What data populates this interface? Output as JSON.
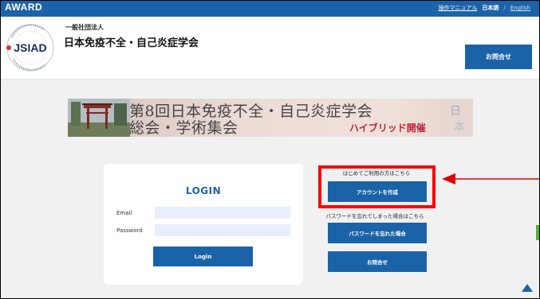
{
  "topbar": {
    "brand": "AWARD",
    "manual_link": "操作マニュアル",
    "lang_ja": "日本語",
    "separator": "/",
    "lang_en": "English"
  },
  "header": {
    "logo_text": "JSIAD",
    "org_type": "一般社団法人",
    "org_name": "日本免疫不全・自己炎症学会",
    "contact_button": "お問合せ"
  },
  "banner": {
    "line1": "第8回日本免疫不全・自己炎症学会",
    "line2": "総会・学術集会",
    "hybrid_label": "ハイブリッド開催"
  },
  "login": {
    "title": "LOGIN",
    "email_label": "Email",
    "email_value": "",
    "password_label": "Password",
    "password_value": "",
    "login_button": "Login"
  },
  "side": {
    "first_time_note": "はじめてご利用の方はこちら",
    "create_account_button": "アカウントを作成",
    "forgot_note": "パスワードを忘れてしまった場合はこちら",
    "forgot_password_button": "パスワードを忘れた場合",
    "contact_button": "お問合せ"
  },
  "colors": {
    "brand_blue": "#1b63a8",
    "highlight_red": "#ff0000",
    "input_bg": "#e8eefb",
    "page_bg": "#f1f1f1"
  },
  "icons": {
    "scroll_top": "triangle-up-icon",
    "annotation": "arrow-left-icon"
  }
}
